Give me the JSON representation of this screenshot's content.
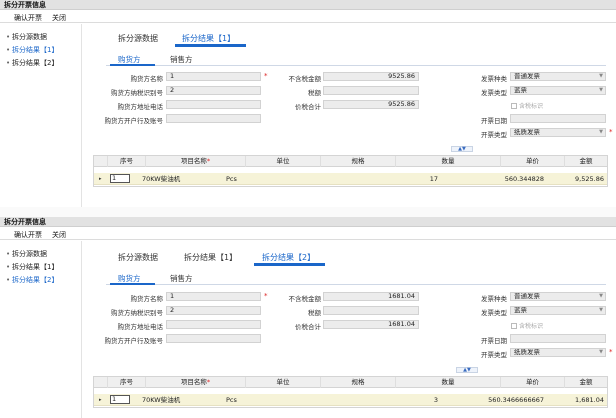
{
  "window": {
    "title": "拆分开票信息"
  },
  "menu": {
    "confirm": "确认开票",
    "close": "关闭"
  },
  "sidebar": {
    "items": [
      {
        "label": "拆分源数据",
        "bullet": "•"
      },
      {
        "label": "拆分结果【1】",
        "bullet": "•"
      },
      {
        "label": "拆分结果【2】",
        "bullet": "•"
      }
    ]
  },
  "tabs": [
    "拆分源数据",
    "拆分结果【1】",
    "拆分结果【2】"
  ],
  "subtabs": {
    "buyer": "购货方",
    "seller": "销售方"
  },
  "labels": {
    "buyer_name": "购货方名称",
    "buyer_taxid": "购货方纳税识别号",
    "buyer_addr": "购货方地址电话",
    "buyer_bank": "购货方开户行及账号",
    "amount_excl_tax": "不含税金额",
    "tax": "税额",
    "total_incl_tax": "价税合计",
    "invoice_kind": "发票种类",
    "invoice_type": "发票类型",
    "tax_included": "含税标识",
    "issue_date": "开票日期",
    "issue_type": "开票类型",
    "required_mark": "*"
  },
  "grid": {
    "headers": [
      "序号",
      "项目名称",
      "单位",
      "规格",
      "数量",
      "单价",
      "金额"
    ],
    "expand_marker": "▸",
    "collapse_marker": "▲▼"
  },
  "results": [
    {
      "active_tab": 1,
      "buyer_name": "1",
      "buyer_taxid": "2",
      "buyer_addr": "",
      "buyer_bank": "",
      "amount_excl_tax": "9525.86",
      "tax": "",
      "total_incl_tax": "9525.86",
      "invoice_kind": "普通发票",
      "invoice_type": "蓝票",
      "issue_date": "",
      "issue_type": "纸质发票",
      "row": {
        "seq": "1",
        "item": "70KW柴油机",
        "unit": "Pcs",
        "spec": "",
        "qty": "17",
        "price": "560.344828",
        "amount": "9,525.86"
      }
    },
    {
      "active_tab": 2,
      "buyer_name": "1",
      "buyer_taxid": "2",
      "buyer_addr": "",
      "buyer_bank": "",
      "amount_excl_tax": "1681.04",
      "tax": "",
      "total_incl_tax": "1681.04",
      "invoice_kind": "普通发票",
      "invoice_type": "蓝票",
      "issue_date": "",
      "issue_type": "纸质发票",
      "row": {
        "seq": "1",
        "item": "70KW柴油机",
        "unit": "Pcs",
        "spec": "",
        "qty": "3",
        "price": "560.3466666667",
        "amount": "1,681.04"
      }
    }
  ]
}
